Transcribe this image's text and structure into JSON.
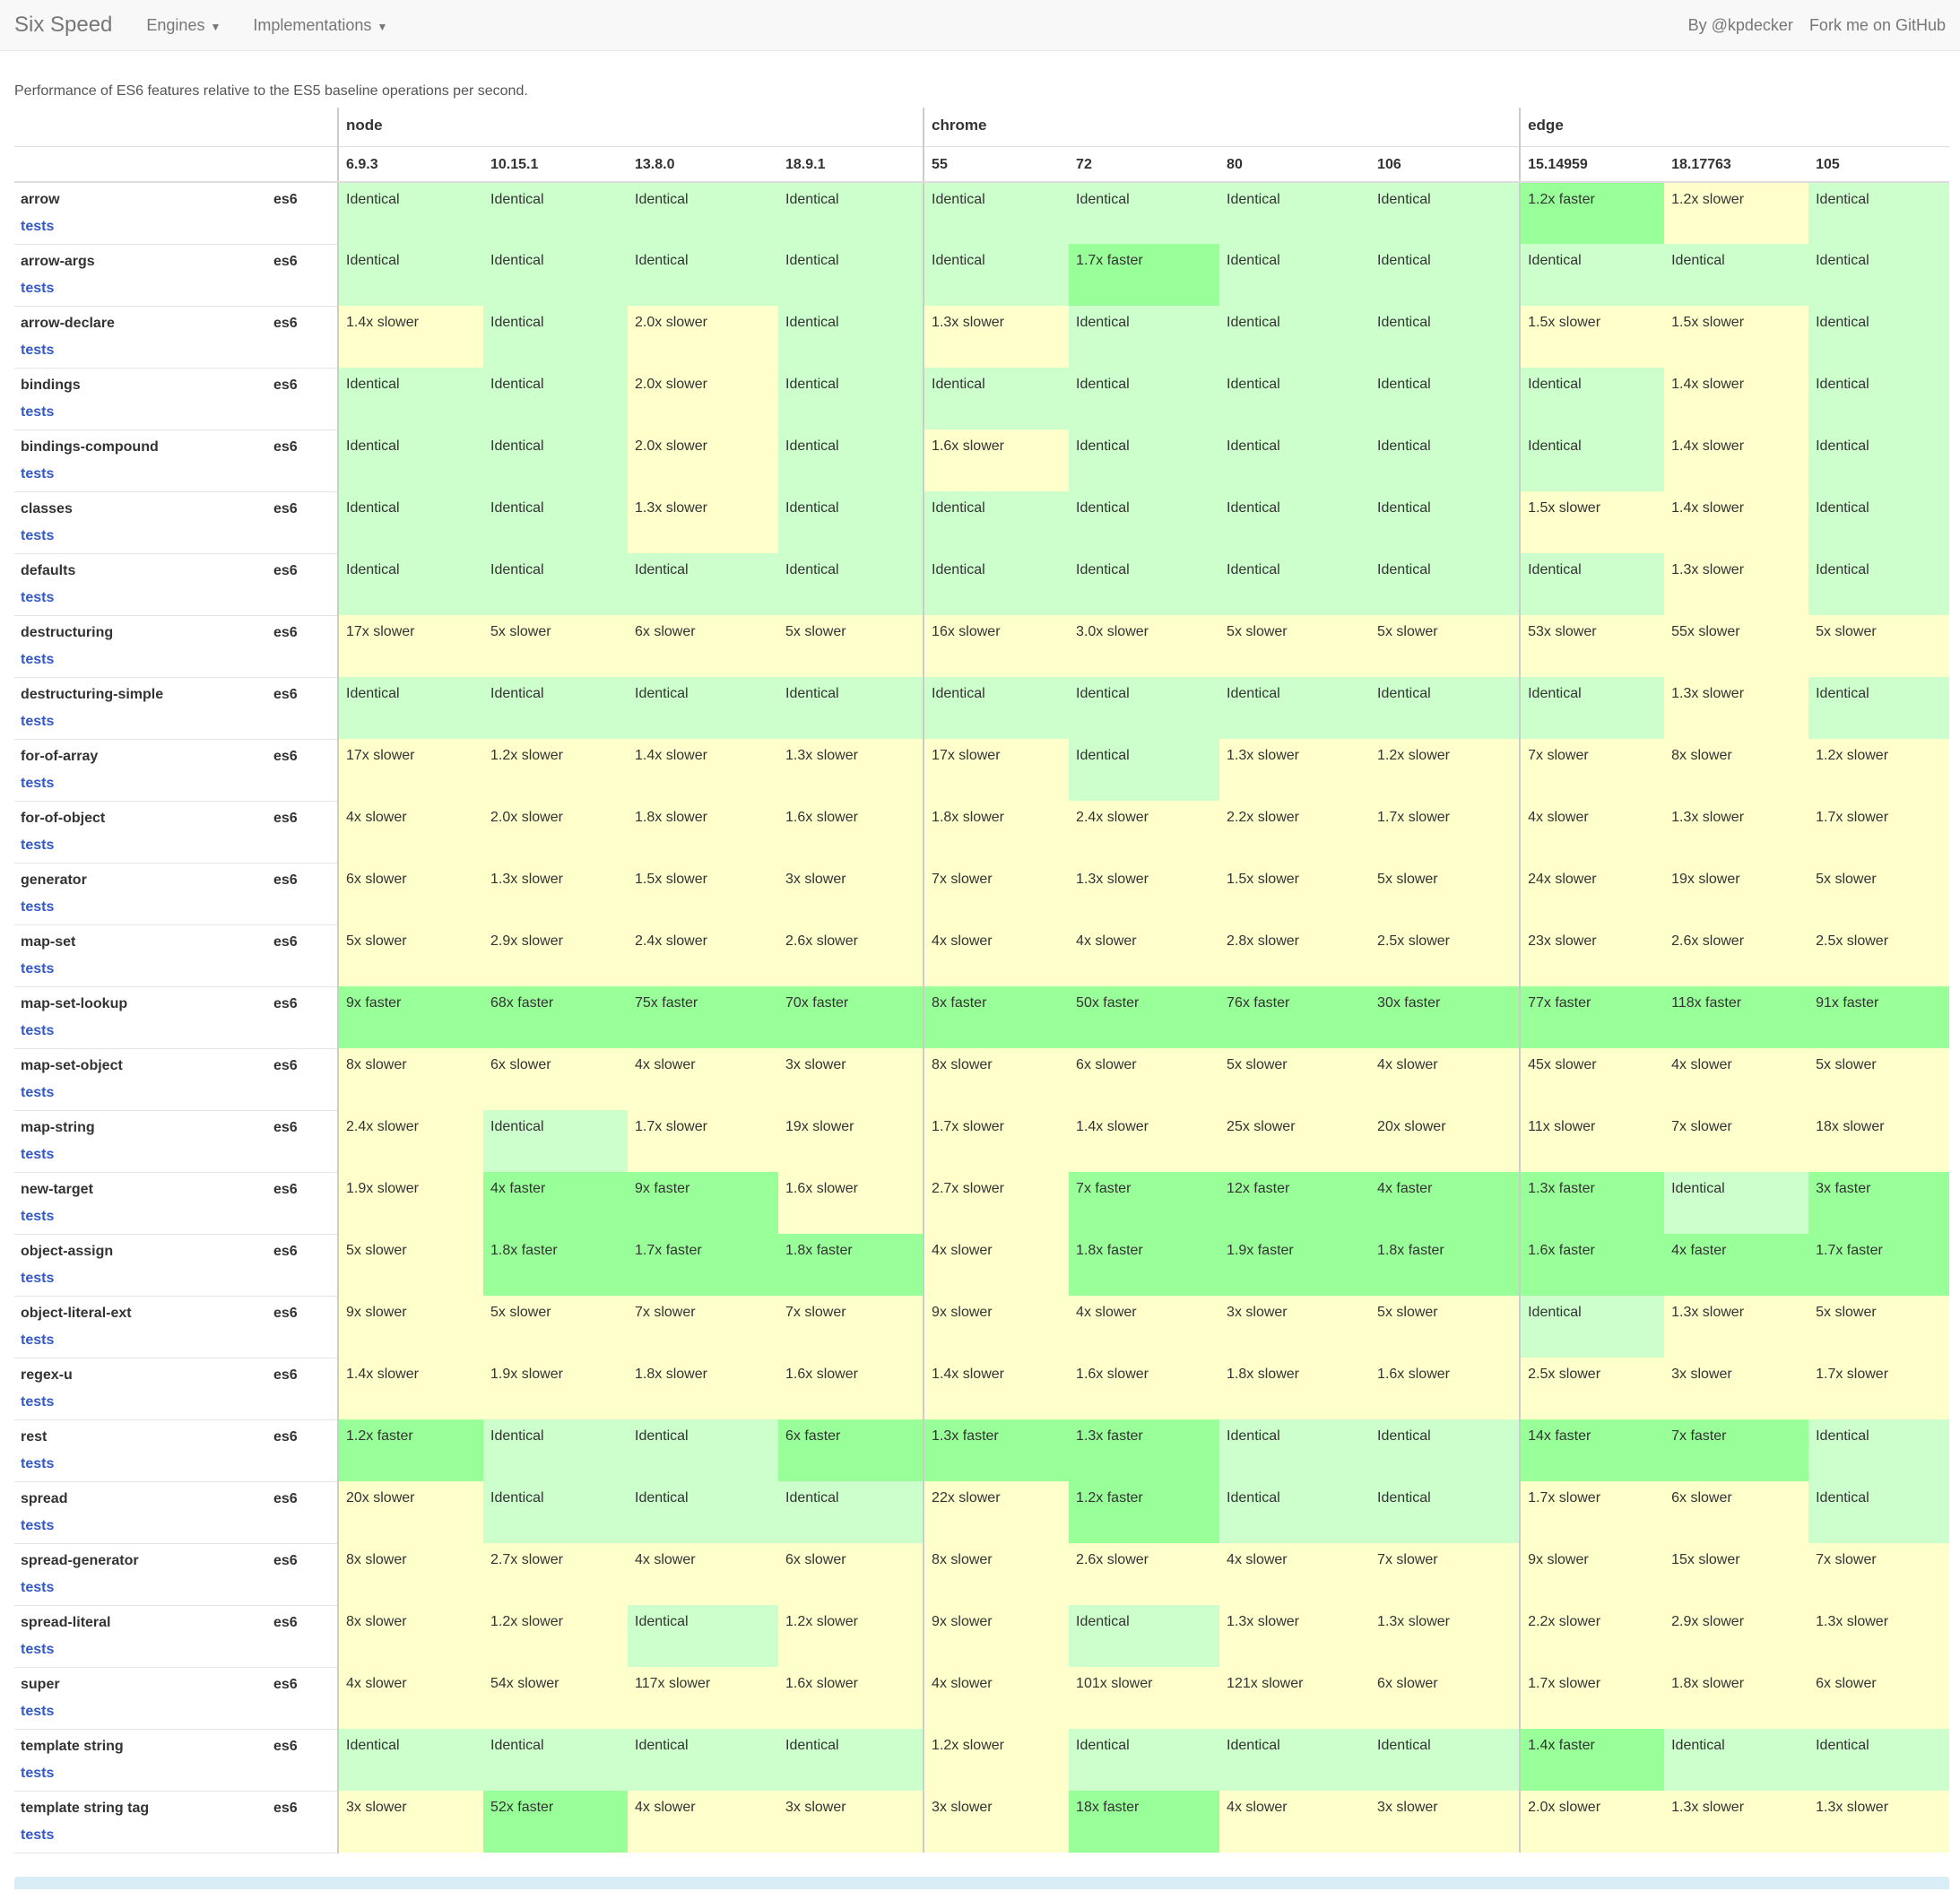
{
  "nav": {
    "brand": "Six Speed",
    "engines": "Engines",
    "implementations": "Implementations",
    "author": "By @kpdecker",
    "github": "Fork me on GitHub"
  },
  "intro": "Performance of ES6 features relative to the ES5 baseline operations per second.",
  "engines": [
    {
      "name": "node",
      "versions": [
        "6.9.3",
        "10.15.1",
        "13.8.0",
        "18.9.1"
      ]
    },
    {
      "name": "chrome",
      "versions": [
        "55",
        "72",
        "80",
        "106"
      ]
    },
    {
      "name": "edge",
      "versions": [
        "15.14959",
        "18.17763",
        "105"
      ]
    }
  ],
  "colors": {
    "identical": "#ccffcc",
    "slower": "#ffffcc",
    "faster": "#99ff99"
  },
  "tests_label": "tests",
  "rows": [
    {
      "name": "arrow",
      "type": "es6",
      "values": [
        "Identical",
        "Identical",
        "Identical",
        "Identical",
        "Identical",
        "Identical",
        "Identical",
        "Identical",
        "1.2x faster",
        "1.2x slower",
        "Identical"
      ]
    },
    {
      "name": "arrow-args",
      "type": "es6",
      "values": [
        "Identical",
        "Identical",
        "Identical",
        "Identical",
        "Identical",
        "1.7x faster",
        "Identical",
        "Identical",
        "Identical",
        "Identical",
        "Identical"
      ]
    },
    {
      "name": "arrow-declare",
      "type": "es6",
      "values": [
        "1.4x slower",
        "Identical",
        "2.0x slower",
        "Identical",
        "1.3x slower",
        "Identical",
        "Identical",
        "Identical",
        "1.5x slower",
        "1.5x slower",
        "Identical"
      ]
    },
    {
      "name": "bindings",
      "type": "es6",
      "values": [
        "Identical",
        "Identical",
        "2.0x slower",
        "Identical",
        "Identical",
        "Identical",
        "Identical",
        "Identical",
        "Identical",
        "1.4x slower",
        "Identical"
      ]
    },
    {
      "name": "bindings-compound",
      "type": "es6",
      "values": [
        "Identical",
        "Identical",
        "2.0x slower",
        "Identical",
        "1.6x slower",
        "Identical",
        "Identical",
        "Identical",
        "Identical",
        "1.4x slower",
        "Identical"
      ]
    },
    {
      "name": "classes",
      "type": "es6",
      "values": [
        "Identical",
        "Identical",
        "1.3x slower",
        "Identical",
        "Identical",
        "Identical",
        "Identical",
        "Identical",
        "1.5x slower",
        "1.4x slower",
        "Identical"
      ]
    },
    {
      "name": "defaults",
      "type": "es6",
      "values": [
        "Identical",
        "Identical",
        "Identical",
        "Identical",
        "Identical",
        "Identical",
        "Identical",
        "Identical",
        "Identical",
        "1.3x slower",
        "Identical"
      ]
    },
    {
      "name": "destructuring",
      "type": "es6",
      "values": [
        "17x slower",
        "5x slower",
        "6x slower",
        "5x slower",
        "16x slower",
        "3.0x slower",
        "5x slower",
        "5x slower",
        "53x slower",
        "55x slower",
        "5x slower"
      ]
    },
    {
      "name": "destructuring-simple",
      "type": "es6",
      "values": [
        "Identical",
        "Identical",
        "Identical",
        "Identical",
        "Identical",
        "Identical",
        "Identical",
        "Identical",
        "Identical",
        "1.3x slower",
        "Identical"
      ]
    },
    {
      "name": "for-of-array",
      "type": "es6",
      "values": [
        "17x slower",
        "1.2x slower",
        "1.4x slower",
        "1.3x slower",
        "17x slower",
        "Identical",
        "1.3x slower",
        "1.2x slower",
        "7x slower",
        "8x slower",
        "1.2x slower"
      ]
    },
    {
      "name": "for-of-object",
      "type": "es6",
      "values": [
        "4x slower",
        "2.0x slower",
        "1.8x slower",
        "1.6x slower",
        "1.8x slower",
        "2.4x slower",
        "2.2x slower",
        "1.7x slower",
        "4x slower",
        "1.3x slower",
        "1.7x slower"
      ]
    },
    {
      "name": "generator",
      "type": "es6",
      "values": [
        "6x slower",
        "1.3x slower",
        "1.5x slower",
        "3x slower",
        "7x slower",
        "1.3x slower",
        "1.5x slower",
        "5x slower",
        "24x slower",
        "19x slower",
        "5x slower"
      ]
    },
    {
      "name": "map-set",
      "type": "es6",
      "values": [
        "5x slower",
        "2.9x slower",
        "2.4x slower",
        "2.6x slower",
        "4x slower",
        "4x slower",
        "2.8x slower",
        "2.5x slower",
        "23x slower",
        "2.6x slower",
        "2.5x slower"
      ]
    },
    {
      "name": "map-set-lookup",
      "type": "es6",
      "values": [
        "9x faster",
        "68x faster",
        "75x faster",
        "70x faster",
        "8x faster",
        "50x faster",
        "76x faster",
        "30x faster",
        "77x faster",
        "118x faster",
        "91x faster"
      ]
    },
    {
      "name": "map-set-object",
      "type": "es6",
      "values": [
        "8x slower",
        "6x slower",
        "4x slower",
        "3x slower",
        "8x slower",
        "6x slower",
        "5x slower",
        "4x slower",
        "45x slower",
        "4x slower",
        "5x slower"
      ]
    },
    {
      "name": "map-string",
      "type": "es6",
      "values": [
        "2.4x slower",
        "Identical",
        "1.7x slower",
        "19x slower",
        "1.7x slower",
        "1.4x slower",
        "25x slower",
        "20x slower",
        "11x slower",
        "7x slower",
        "18x slower"
      ]
    },
    {
      "name": "new-target",
      "type": "es6",
      "values": [
        "1.9x slower",
        "4x faster",
        "9x faster",
        "1.6x slower",
        "2.7x slower",
        "7x faster",
        "12x faster",
        "4x faster",
        "1.3x faster",
        "Identical",
        "3x faster"
      ]
    },
    {
      "name": "object-assign",
      "type": "es6",
      "values": [
        "5x slower",
        "1.8x faster",
        "1.7x faster",
        "1.8x faster",
        "4x slower",
        "1.8x faster",
        "1.9x faster",
        "1.8x faster",
        "1.6x faster",
        "4x faster",
        "1.7x faster"
      ]
    },
    {
      "name": "object-literal-ext",
      "type": "es6",
      "values": [
        "9x slower",
        "5x slower",
        "7x slower",
        "7x slower",
        "9x slower",
        "4x slower",
        "3x slower",
        "5x slower",
        "Identical",
        "1.3x slower",
        "5x slower"
      ]
    },
    {
      "name": "regex-u",
      "type": "es6",
      "values": [
        "1.4x slower",
        "1.9x slower",
        "1.8x slower",
        "1.6x slower",
        "1.4x slower",
        "1.6x slower",
        "1.8x slower",
        "1.6x slower",
        "2.5x slower",
        "3x slower",
        "1.7x slower"
      ]
    },
    {
      "name": "rest",
      "type": "es6",
      "values": [
        "1.2x faster",
        "Identical",
        "Identical",
        "6x faster",
        "1.3x faster",
        "1.3x faster",
        "Identical",
        "Identical",
        "14x faster",
        "7x faster",
        "Identical"
      ]
    },
    {
      "name": "spread",
      "type": "es6",
      "values": [
        "20x slower",
        "Identical",
        "Identical",
        "Identical",
        "22x slower",
        "1.2x faster",
        "Identical",
        "Identical",
        "1.7x slower",
        "6x slower",
        "Identical"
      ]
    },
    {
      "name": "spread-generator",
      "type": "es6",
      "values": [
        "8x slower",
        "2.7x slower",
        "4x slower",
        "6x slower",
        "8x slower",
        "2.6x slower",
        "4x slower",
        "7x slower",
        "9x slower",
        "15x slower",
        "7x slower"
      ]
    },
    {
      "name": "spread-literal",
      "type": "es6",
      "values": [
        "8x slower",
        "1.2x slower",
        "Identical",
        "1.2x slower",
        "9x slower",
        "Identical",
        "1.3x slower",
        "1.3x slower",
        "2.2x slower",
        "2.9x slower",
        "1.3x slower"
      ]
    },
    {
      "name": "super",
      "type": "es6",
      "values": [
        "4x slower",
        "54x slower",
        "117x slower",
        "1.6x slower",
        "4x slower",
        "101x slower",
        "121x slower",
        "6x slower",
        "1.7x slower",
        "1.8x slower",
        "6x slower"
      ]
    },
    {
      "name": "template string",
      "type": "es6",
      "values": [
        "Identical",
        "Identical",
        "Identical",
        "Identical",
        "1.2x slower",
        "Identical",
        "Identical",
        "Identical",
        "1.4x faster",
        "Identical",
        "Identical"
      ]
    },
    {
      "name": "template string tag",
      "type": "es6",
      "values": [
        "3x slower",
        "52x faster",
        "4x slower",
        "3x slower",
        "3x slower",
        "18x faster",
        "4x slower",
        "3x slower",
        "2.0x slower",
        "1.3x slower",
        "1.3x slower"
      ]
    }
  ]
}
